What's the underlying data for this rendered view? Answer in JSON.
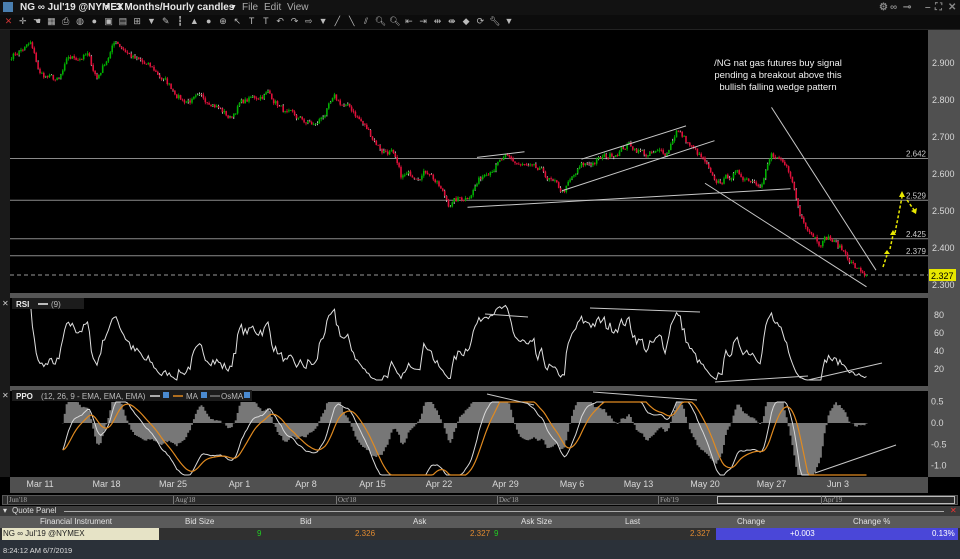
{
  "window": {
    "symbol": "NG ∞ Jul'19 @NYMEX",
    "timeframe": "3 Months/Hourly candles",
    "menus": [
      "File",
      "Edit",
      "View"
    ],
    "toolbar_icons": [
      "close-icon",
      "crosshair-icon",
      "pointer-icon",
      "grid-icon",
      "print-icon",
      "globe-icon",
      "circle-icon",
      "image-icon",
      "picture-icon",
      "layout-icon",
      "triangle-down-icon",
      "pencil-icon",
      "bars-icon",
      "mountain-icon",
      "ball-icon",
      "target-icon",
      "cursor-icon",
      "text-icon",
      "text-box-icon",
      "undo-icon",
      "redo-icon",
      "arrow-icon",
      "triangle-down-icon",
      "line-tool-icon",
      "trendline-icon",
      "channel-icon",
      "zoom-in-icon",
      "zoom-out-icon",
      "shift-left-icon",
      "shift-right-icon",
      "expand-icon",
      "compress-icon",
      "paint-icon",
      "refresh-icon",
      "wrench-icon",
      "triangle-down-icon"
    ],
    "window_icons": [
      "gear-icon",
      "link-icon",
      "pin-icon",
      "minimize-icon",
      "maximize-icon",
      "close-icon"
    ]
  },
  "chart_data": [
    {
      "type": "candlestick",
      "title": "",
      "interval": "hourly",
      "ylim": [
        2.27,
        2.98
      ],
      "yticks": [
        "2.900",
        "2.800",
        "2.700",
        "2.600",
        "2.500",
        "2.400",
        "2.300"
      ],
      "ytick_values": [
        2.9,
        2.8,
        2.7,
        2.6,
        2.5,
        2.4,
        2.3
      ],
      "xticks": [
        "Mar 11",
        "Mar 18",
        "Mar 25",
        "Apr 1",
        "Apr 8",
        "Apr 15",
        "Apr 22",
        "Apr 29",
        "May 6",
        "May 13",
        "May 20",
        "May 27",
        "Jun 3"
      ],
      "xtick_dates": [
        "2019-03-11",
        "2019-03-18",
        "2019-03-25",
        "2019-04-01",
        "2019-04-08",
        "2019-04-15",
        "2019-04-22",
        "2019-04-29",
        "2019-05-06",
        "2019-05-13",
        "2019-05-20",
        "2019-05-27",
        "2019-06-03"
      ],
      "price_path": [
        [
          "2019-03-08",
          2.92
        ],
        [
          "2019-03-10",
          2.95
        ],
        [
          "2019-03-11",
          2.87
        ],
        [
          "2019-03-13",
          2.85
        ],
        [
          "2019-03-14",
          2.91
        ],
        [
          "2019-03-16",
          2.92
        ],
        [
          "2019-03-17",
          2.86
        ],
        [
          "2019-03-19",
          2.96
        ],
        [
          "2019-03-21",
          2.91
        ],
        [
          "2019-03-23",
          2.88
        ],
        [
          "2019-03-25",
          2.83
        ],
        [
          "2019-03-26",
          2.8
        ],
        [
          "2019-03-29",
          2.8
        ],
        [
          "2019-03-31",
          2.75
        ],
        [
          "2019-04-01",
          2.79
        ],
        [
          "2019-04-04",
          2.82
        ],
        [
          "2019-04-06",
          2.76
        ],
        [
          "2019-04-09",
          2.73
        ],
        [
          "2019-04-11",
          2.8
        ],
        [
          "2019-04-13",
          2.77
        ],
        [
          "2019-04-16",
          2.665
        ],
        [
          "2019-04-17",
          2.66
        ],
        [
          "2019-04-18",
          2.59
        ],
        [
          "2019-04-21",
          2.61
        ],
        [
          "2019-04-23",
          2.52
        ],
        [
          "2019-04-25",
          2.54
        ],
        [
          "2019-04-27",
          2.61
        ],
        [
          "2019-04-29",
          2.64
        ],
        [
          "2019-05-01",
          2.62
        ],
        [
          "2019-05-03",
          2.6
        ],
        [
          "2019-05-05",
          2.55
        ],
        [
          "2019-05-07",
          2.62
        ],
        [
          "2019-05-10",
          2.65
        ],
        [
          "2019-05-12",
          2.68
        ],
        [
          "2019-05-14",
          2.65
        ],
        [
          "2019-05-16",
          2.66
        ],
        [
          "2019-05-17",
          2.72
        ],
        [
          "2019-05-20",
          2.63
        ],
        [
          "2019-05-21",
          2.57
        ],
        [
          "2019-05-23",
          2.6
        ],
        [
          "2019-05-26",
          2.58
        ],
        [
          "2019-05-27",
          2.65
        ],
        [
          "2019-05-29",
          2.6
        ],
        [
          "2019-05-30",
          2.49
        ],
        [
          "2019-06-01",
          2.42
        ],
        [
          "2019-06-02",
          2.43
        ],
        [
          "2019-06-04",
          2.38
        ],
        [
          "2019-06-05",
          2.34
        ],
        [
          "2019-06-06",
          2.327
        ]
      ],
      "last_price": "2.327",
      "last_price_value": 2.327,
      "horizontal_levels": [
        {
          "label": "2.642",
          "value": 2.642
        },
        {
          "label": "2.529",
          "value": 2.529
        },
        {
          "label": "2.425",
          "value": 2.425
        },
        {
          "label": "2.379",
          "value": 2.379
        }
      ],
      "trendlines": [
        [
          [
            "2019-04-25",
            2.51
          ],
          [
            "2019-05-29",
            2.56
          ]
        ],
        [
          [
            "2019-04-26",
            2.645
          ],
          [
            "2019-05-01",
            2.66
          ]
        ],
        [
          [
            "2019-05-07",
            2.64
          ],
          [
            "2019-05-18",
            2.73
          ]
        ],
        [
          [
            "2019-05-05",
            2.555
          ],
          [
            "2019-05-21",
            2.69
          ]
        ],
        [
          [
            "2019-05-27",
            2.78
          ],
          [
            "2019-06-07",
            2.34
          ]
        ],
        [
          [
            "2019-05-20",
            2.575
          ],
          [
            "2019-06-06",
            2.295
          ]
        ]
      ],
      "annotation": "/NG nat gas futures buy signal\npending a breakout above this\nbullish falling wedge pattern",
      "colors": {
        "up": "#00b000",
        "down": "#e0103a",
        "level": "#8a8a8a",
        "trendline": "#c8c8c8",
        "projection": "#e8e800",
        "last_price_badge": "#e8e800"
      }
    },
    {
      "type": "line",
      "name": "RSI",
      "params": "(9)",
      "ylim": [
        0,
        100
      ],
      "yticks": [
        "80",
        "60",
        "40",
        "20"
      ],
      "ytick_values": [
        80,
        60,
        40,
        20
      ],
      "color": "#e0e0e0"
    },
    {
      "type": "line",
      "name": "PPO",
      "params": "(12, 26, 9 - EMA, EMA, EMA)",
      "legend": [
        "MA",
        "OsMA"
      ],
      "ylim": [
        -1.2,
        0.7
      ],
      "yticks": [
        "0.5",
        "0.0",
        "-0.5",
        "-1.0"
      ],
      "ytick_values": [
        0.5,
        0,
        -0.5,
        -1.0
      ],
      "colors": {
        "ppo": "#d8d8d8",
        "ma": "#e08a20",
        "osma": "#777777"
      }
    }
  ],
  "scroller": {
    "labels": [
      "Jun'18",
      "Aug'18",
      "Oct'18",
      "Dec'18",
      "Feb'19",
      "Apr'19"
    ]
  },
  "quote_panel": {
    "title": "Quote Panel",
    "columns": [
      "Financial Instrument",
      "Bid Size",
      "Bid",
      "Ask",
      "Ask Size",
      "Last",
      "Change",
      "Change %"
    ],
    "row": {
      "instrument": "NG ∞ Jul'19 @NYMEX",
      "bid_size": "9",
      "bid": "2.326",
      "ask": "2.327",
      "ask_size": "9",
      "last": "2.327",
      "change": "+0.003",
      "change_pct": "0.13%"
    }
  },
  "status": {
    "time": "8:24:12 AM 6/7/2019"
  }
}
